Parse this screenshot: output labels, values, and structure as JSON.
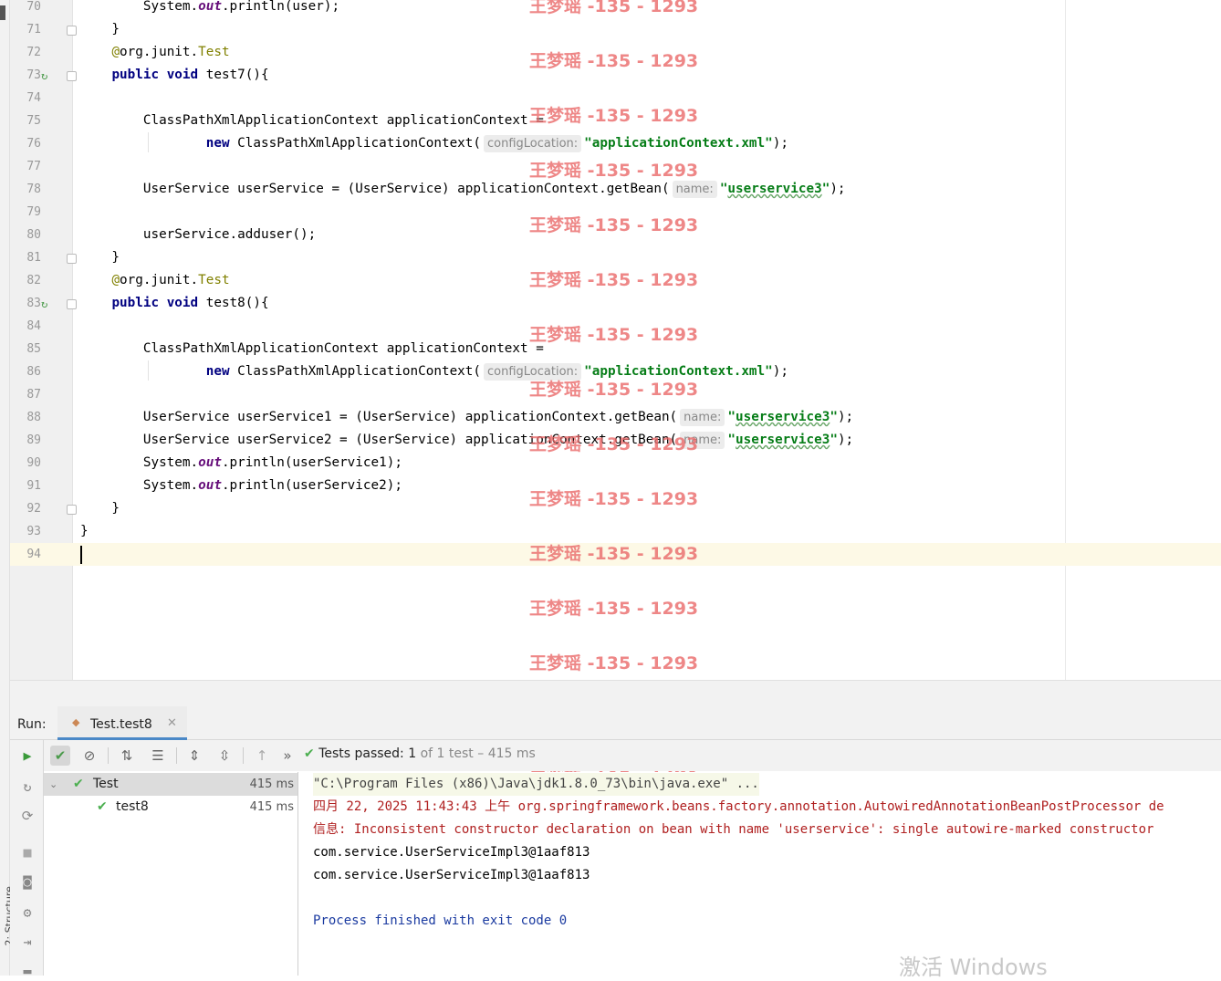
{
  "editor": {
    "lines": [
      {
        "n": "70",
        "html": "        System.<span class=\"fld\">out</span>.println(user);"
      },
      {
        "n": "71",
        "html": "    }",
        "fold": true
      },
      {
        "n": "72",
        "html": "    <span class=\"ann\">@</span>org.junit.<span class=\"ann\">Test</span>"
      },
      {
        "n": "73",
        "html": "    <span class=\"kw\">public void</span> test7(){",
        "run": true,
        "fold": true
      },
      {
        "n": "74",
        "html": ""
      },
      {
        "n": "75",
        "html": "        ClassPathXmlApplicationContext applicationContext ="
      },
      {
        "n": "76",
        "html": "                <span class=\"kw\">new</span> ClassPathXmlApplicationContext(<span class=\"hint\">configLocation:</span><span class=\"str\">\"applicationContext.xml\"</span>);"
      },
      {
        "n": "77",
        "html": ""
      },
      {
        "n": "78",
        "html": "        UserService userService = (UserService) applicationContext.getBean(<span class=\"hint\">name:</span><span class=\"str\">\"<span class=\"squig\">userservice3</span>\"</span>);"
      },
      {
        "n": "79",
        "html": ""
      },
      {
        "n": "80",
        "html": "        userService.adduser();"
      },
      {
        "n": "81",
        "html": "    }",
        "fold": true
      },
      {
        "n": "82",
        "html": "    <span class=\"ann\">@</span>org.junit.<span class=\"ann\">Test</span>"
      },
      {
        "n": "83",
        "html": "    <span class=\"kw\">public void</span> test8(){",
        "run": true,
        "fold": true
      },
      {
        "n": "84",
        "html": ""
      },
      {
        "n": "85",
        "html": "        ClassPathXmlApplicationContext applicationContext ="
      },
      {
        "n": "86",
        "html": "                <span class=\"kw\">new</span> ClassPathXmlApplicationContext(<span class=\"hint\">configLocation:</span><span class=\"str\">\"applicationContext.xml\"</span>);"
      },
      {
        "n": "87",
        "html": ""
      },
      {
        "n": "88",
        "html": "        UserService userService1 = (UserService) applicationContext.getBean(<span class=\"hint\">name:</span><span class=\"str\">\"<span class=\"squig\">userservice3</span>\"</span>);"
      },
      {
        "n": "89",
        "html": "        UserService userService2 = (UserService) applicationContext.getBean(<span class=\"hint\">name:</span><span class=\"str\">\"<span class=\"squig\">userservice3</span>\"</span>);"
      },
      {
        "n": "90",
        "html": "        System.<span class=\"fld\">out</span>.println(userService1);"
      },
      {
        "n": "91",
        "html": "        System.<span class=\"fld\">out</span>.println(userService2);"
      },
      {
        "n": "92",
        "html": "    }",
        "fold": true
      },
      {
        "n": "93",
        "html": "}"
      },
      {
        "n": "94",
        "html": "",
        "current": true
      }
    ]
  },
  "watermark": {
    "text": "王梦瑶 -135 - 1293"
  },
  "run_panel": {
    "label": "Run:",
    "tab_label": "Test.test8",
    "status_prefix": "Tests passed:",
    "status_count": "1",
    "status_rest": "of 1 test – 415 ms"
  },
  "test_tree": [
    {
      "label": "Test",
      "duration": "415 ms",
      "selected": true,
      "indent": 0
    },
    {
      "label": "test8",
      "duration": "415 ms",
      "selected": false,
      "indent": 1
    }
  ],
  "console": [
    {
      "text": "\"C:\\Program Files (x86)\\Java\\jdk1.8.0_73\\bin\\java.exe\" ...",
      "style": "cmd"
    },
    {
      "text": "四月 22, 2025 11:43:43 上午 org.springframework.beans.factory.annotation.AutowiredAnnotationBeanPostProcessor de",
      "style": "red"
    },
    {
      "text": "信息: Inconsistent constructor declaration on bean with name 'userservice': single autowire-marked constructor",
      "style": "red"
    },
    {
      "text": "com.service.UserServiceImpl3@1aaf813",
      "style": ""
    },
    {
      "text": "com.service.UserServiceImpl3@1aaf813",
      "style": ""
    },
    {
      "text": "",
      "style": ""
    },
    {
      "text": "Process finished with exit code 0",
      "style": "blue"
    }
  ],
  "left_strip_label": "2: Structure",
  "os_overlay": "激活 Windows",
  "icons": [
    "rerun-icon",
    "check-icon",
    "stop-icon",
    "sort-alpha-icon",
    "sort-duration-icon",
    "expand-all-icon",
    "collapse-all-icon",
    "prev-failed-icon",
    "more-icon",
    "run-gutter-icon"
  ]
}
